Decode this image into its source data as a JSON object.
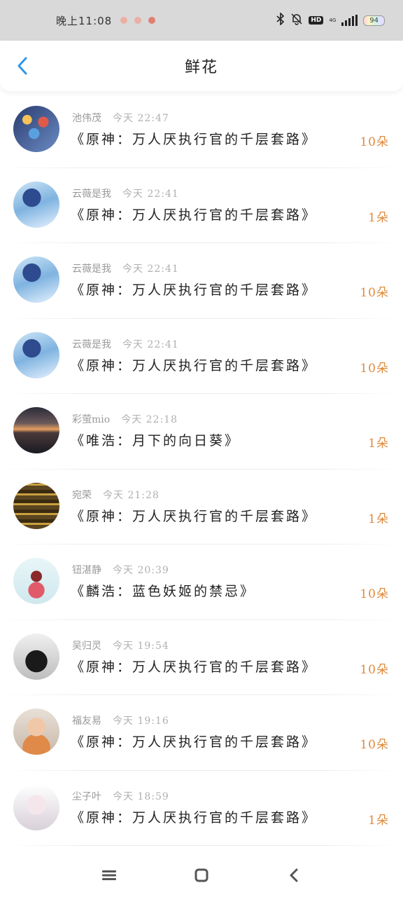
{
  "status_bar": {
    "time": "晚上11:08",
    "network": "4G",
    "hd": "HD",
    "battery": "94"
  },
  "header": {
    "title": "鲜花",
    "back_icon": "chevron-left-icon",
    "accent_color": "#2f97e8"
  },
  "gifts": [
    {
      "user": "池伟茂",
      "time": "今天 22:47",
      "story": "《原神：万人厌执行官的千层套路》",
      "amount": "10朵"
    },
    {
      "user": "云薇是我",
      "time": "今天 22:41",
      "story": "《原神：万人厌执行官的千层套路》",
      "amount": "1朵"
    },
    {
      "user": "云薇是我",
      "time": "今天 22:41",
      "story": "《原神：万人厌执行官的千层套路》",
      "amount": "10朵"
    },
    {
      "user": "云薇是我",
      "time": "今天 22:41",
      "story": "《原神：万人厌执行官的千层套路》",
      "amount": "10朵"
    },
    {
      "user": "彩萤mio",
      "time": "今天 22:18",
      "story": "《唯浩：月下的向日葵》",
      "amount": "1朵"
    },
    {
      "user": "宛荣",
      "time": "今天 21:28",
      "story": "《原神：万人厌执行官的千层套路》",
      "amount": "1朵"
    },
    {
      "user": "钮湛静",
      "time": "今天 20:39",
      "story": "《麟浩：蓝色妖姬的禁忌》",
      "amount": "10朵"
    },
    {
      "user": "吴归灵",
      "time": "今天 19:54",
      "story": "《原神：万人厌执行官的千层套路》",
      "amount": "10朵"
    },
    {
      "user": "福友易",
      "time": "今天 19:16",
      "story": "《原神：万人厌执行官的千层套路》",
      "amount": "10朵"
    },
    {
      "user": "尘子叶",
      "time": "今天 18:59",
      "story": "《原神：万人厌执行官的千层套路》",
      "amount": "1朵"
    }
  ],
  "nav_bar": {
    "menu_icon": "menu-icon",
    "home_icon": "home-square-icon",
    "back_icon": "back-chevron-icon"
  },
  "colors": {
    "amount": "#e08a3c",
    "status_bar_bg": "#d9d9d9"
  }
}
